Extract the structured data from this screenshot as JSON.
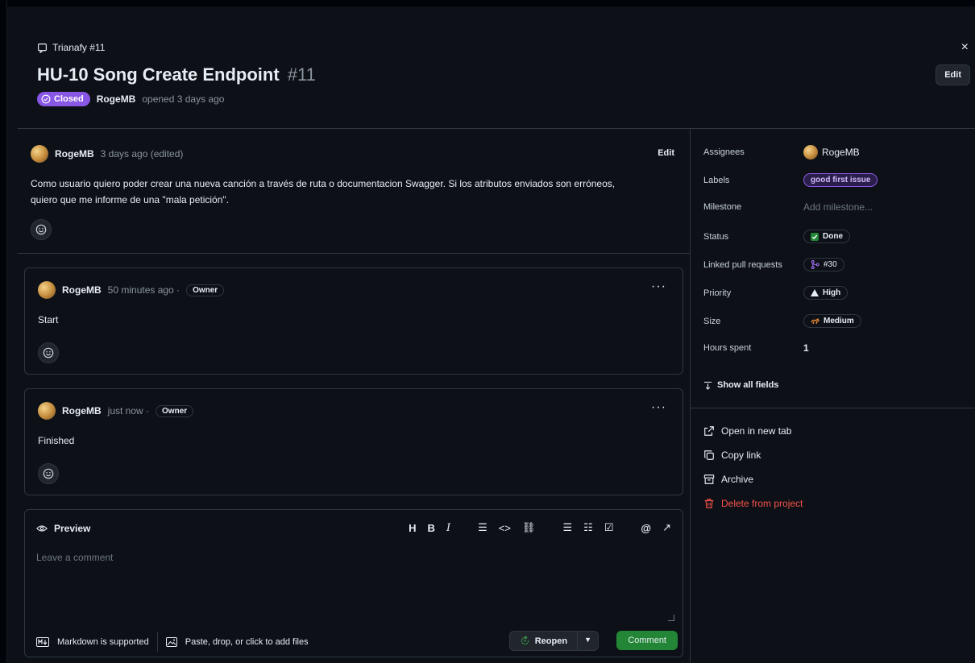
{
  "header": {
    "repo": "Trianafy #11",
    "title": "HU-10 Song Create Endpoint",
    "number": "#11",
    "state": "Closed",
    "author": "RogeMB",
    "opened_text": "opened 3 days ago",
    "edit_label": "Edit",
    "close_glyph": "×"
  },
  "comments": [
    {
      "user": "RogeMB",
      "meta": "3 days ago (edited)",
      "edit_label": "Edit",
      "body": "Como usuario quiero poder crear una nueva canción a través de ruta o documentacion Swagger. Si los atributos enviados son erróneos, quiero que me informe de una \"mala petición\"."
    },
    {
      "user": "RogeMB",
      "meta": "50 minutes ago ·",
      "role": "Owner",
      "body": "Start",
      "menu": "···"
    },
    {
      "user": "RogeMB",
      "meta": "just now ·",
      "role": "Owner",
      "body": "Finished",
      "menu": "···"
    }
  ],
  "composer": {
    "tab": "Preview",
    "placeholder": "Leave a comment",
    "markdown": "Markdown is supported",
    "attach": "Paste, drop, or click to add files",
    "reopen": "Reopen",
    "comment": "Comment",
    "toolbar": {
      "heading": "H",
      "bold": "B",
      "italic": "I",
      "quote": "☰",
      "code": "<>",
      "link": "⛓",
      "ul": "☰",
      "ol": "☷",
      "task": "☑",
      "mention": "@",
      "reference": "↗"
    }
  },
  "sidebar": {
    "assignees_label": "Assignees",
    "assignee": "RogeMB",
    "labels_label": "Labels",
    "label": "good first issue",
    "milestone_label": "Milestone",
    "milestone": "Add milestone...",
    "status_label": "Status",
    "status": "Done",
    "linked_label": "Linked pull requests",
    "linked": "#30",
    "priority_label": "Priority",
    "priority": "High",
    "size_label": "Size",
    "size": "Medium",
    "hours_label": "Hours spent",
    "hours": "1",
    "show_all": "Show all fields",
    "actions": {
      "open_new_tab": "Open in new tab",
      "copy_link": "Copy link",
      "archive": "Archive",
      "delete": "Delete from project"
    }
  },
  "colors": {
    "closed": "#8957e5",
    "done": "#238636",
    "danger": "#f85149",
    "label_border": "#8957e5"
  }
}
